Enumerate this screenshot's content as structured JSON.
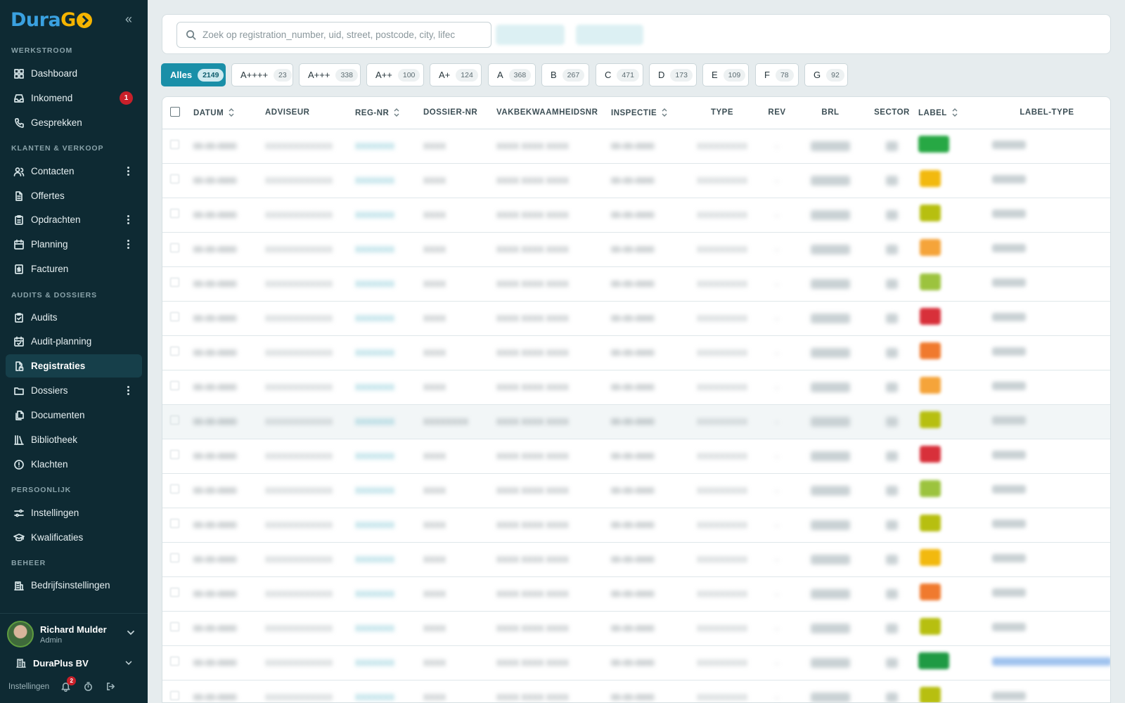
{
  "brand": {
    "part1": "Dura",
    "part2": "G"
  },
  "sidebar": {
    "sections": [
      {
        "title": "WERKSTROOM",
        "items": [
          {
            "label": "Dashboard",
            "icon": "dashboard-icon"
          },
          {
            "label": "Inkomend",
            "icon": "inbox-icon",
            "badge": "1"
          },
          {
            "label": "Gesprekken",
            "icon": "phone-icon"
          }
        ]
      },
      {
        "title": "KLANTEN & VERKOOP",
        "items": [
          {
            "label": "Contacten",
            "icon": "users-icon",
            "more": true
          },
          {
            "label": "Offertes",
            "icon": "document-icon"
          },
          {
            "label": "Opdrachten",
            "icon": "clipboard-icon",
            "more": true
          },
          {
            "label": "Planning",
            "icon": "calendar-icon",
            "more": true
          },
          {
            "label": "Facturen",
            "icon": "invoice-icon"
          }
        ]
      },
      {
        "title": "AUDITS & DOSSIERS",
        "items": [
          {
            "label": "Audits",
            "icon": "clipboard-check-icon"
          },
          {
            "label": "Audit-planning",
            "icon": "calendar-check-icon"
          },
          {
            "label": "Registraties",
            "icon": "file-lock-icon",
            "active": true
          },
          {
            "label": "Dossiers",
            "icon": "folder-icon",
            "more": true
          },
          {
            "label": "Documenten",
            "icon": "files-icon"
          },
          {
            "label": "Bibliotheek",
            "icon": "library-icon"
          },
          {
            "label": "Klachten",
            "icon": "alert-circle-icon"
          }
        ]
      },
      {
        "title": "PERSOONLIJK",
        "items": [
          {
            "label": "Instellingen",
            "icon": "sliders-icon"
          },
          {
            "label": "Kwalificaties",
            "icon": "graduation-cap-icon"
          }
        ]
      },
      {
        "title": "BEHEER",
        "items": [
          {
            "label": "Bedrijfsinstellingen",
            "icon": "building-icon"
          }
        ]
      }
    ],
    "user": {
      "name": "Richard Mulder",
      "role": "Admin"
    },
    "org": {
      "name": "DuraPlus BV"
    },
    "footer": {
      "settings_label": "Instellingen",
      "notification_count": "2"
    }
  },
  "search": {
    "placeholder": "Zoek op registration_number, uid, street, postcode, city, lifec"
  },
  "filters": [
    {
      "label": "Alles",
      "count": "2149",
      "active": true
    },
    {
      "label": "A++++",
      "count": "23"
    },
    {
      "label": "A+++",
      "count": "338"
    },
    {
      "label": "A++",
      "count": "100"
    },
    {
      "label": "A+",
      "count": "124"
    },
    {
      "label": "A",
      "count": "368"
    },
    {
      "label": "B",
      "count": "267"
    },
    {
      "label": "C",
      "count": "471"
    },
    {
      "label": "D",
      "count": "173"
    },
    {
      "label": "E",
      "count": "109"
    },
    {
      "label": "F",
      "count": "78"
    },
    {
      "label": "G",
      "count": "92"
    }
  ],
  "table": {
    "columns": [
      "DATUM",
      "ADVISEUR",
      "REG-NR",
      "DOSSIER-NR",
      "VAKBEKWAAMHEIDSNR",
      "INSPECTIE",
      "TYPE",
      "REV",
      "BRL",
      "SECTOR",
      "LABEL",
      "LABEL-TYPE"
    ],
    "row_label_colors": [
      "#27a844",
      "#f2b90f",
      "#b7bf10",
      "#f5a43a",
      "#9cc33e",
      "#d8303a",
      "#f07a2e",
      "#f5a43a",
      "#b7bf10",
      "#d8303a",
      "#9cc33e",
      "#b7bf10",
      "#f2b90f",
      "#f07a2e",
      "#b7bf10",
      "#1f9a44",
      "#b7bf10"
    ]
  }
}
